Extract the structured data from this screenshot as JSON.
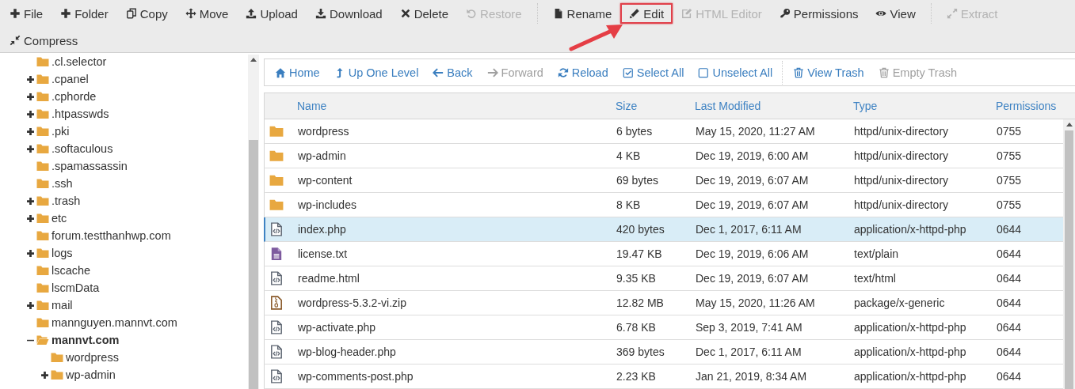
{
  "toolbar": {
    "callout_arrow": true,
    "groups": [
      {
        "buttons": [
          {
            "label": "File",
            "kind": "plus",
            "disabled": false,
            "highlighted": false
          },
          {
            "label": "Folder",
            "kind": "plus",
            "disabled": false,
            "highlighted": false
          },
          {
            "label": "Copy",
            "kind": "copy",
            "disabled": false,
            "highlighted": false
          },
          {
            "label": "Move",
            "kind": "move",
            "disabled": false,
            "highlighted": false
          },
          {
            "label": "Upload",
            "kind": "upload",
            "disabled": false,
            "highlighted": false
          },
          {
            "label": "Download",
            "kind": "download",
            "disabled": false,
            "highlighted": false
          },
          {
            "label": "Delete",
            "kind": "times",
            "disabled": false,
            "highlighted": false
          },
          {
            "label": "Restore",
            "kind": "undo",
            "disabled": true,
            "highlighted": false
          }
        ]
      },
      {
        "buttons": [
          {
            "label": "Rename",
            "kind": "file",
            "disabled": false,
            "highlighted": false
          },
          {
            "label": "Edit",
            "kind": "pencil",
            "disabled": false,
            "highlighted": true
          },
          {
            "label": "HTML Editor",
            "kind": "edit",
            "disabled": true,
            "highlighted": false
          },
          {
            "label": "Permissions",
            "kind": "key",
            "disabled": false,
            "highlighted": false
          },
          {
            "label": "View",
            "kind": "eye",
            "disabled": false,
            "highlighted": false
          }
        ]
      },
      {
        "buttons": [
          {
            "label": "Extract",
            "kind": "expand",
            "disabled": true,
            "highlighted": false
          },
          {
            "label": "Compress",
            "kind": "compress",
            "disabled": false,
            "highlighted": false
          }
        ]
      }
    ]
  },
  "tree": [
    {
      "label": ".cl.selector",
      "kind": "leaf",
      "selected": false
    },
    {
      "label": ".cpanel",
      "kind": "collapsed",
      "selected": false
    },
    {
      "label": ".cphorde",
      "kind": "collapsed",
      "selected": false
    },
    {
      "label": ".htpasswds",
      "kind": "collapsed",
      "selected": false
    },
    {
      "label": ".pki",
      "kind": "collapsed",
      "selected": false
    },
    {
      "label": ".softaculous",
      "kind": "collapsed",
      "selected": false
    },
    {
      "label": ".spamassassin",
      "kind": "leaf",
      "selected": false
    },
    {
      "label": ".ssh",
      "kind": "leaf",
      "selected": false
    },
    {
      "label": ".trash",
      "kind": "collapsed",
      "selected": false
    },
    {
      "label": "etc",
      "kind": "collapsed",
      "selected": false
    },
    {
      "label": "forum.testthanhwp.com",
      "kind": "leaf",
      "selected": false
    },
    {
      "label": "logs",
      "kind": "collapsed",
      "selected": false
    },
    {
      "label": "lscache",
      "kind": "leaf",
      "selected": false
    },
    {
      "label": "lscmData",
      "kind": "leaf",
      "selected": false
    },
    {
      "label": "mail",
      "kind": "collapsed",
      "selected": false
    },
    {
      "label": "mannguyen.mannvt.com",
      "kind": "leaf",
      "selected": false
    },
    {
      "label": "mannvt.com",
      "kind": "expanded",
      "selected": true,
      "children": [
        {
          "label": "wordpress",
          "kind": "leaf",
          "selected": false
        },
        {
          "label": "wp-admin",
          "kind": "collapsed",
          "selected": false
        }
      ]
    }
  ],
  "nav": {
    "groups": [
      {
        "buttons": [
          {
            "label": "Home",
            "kind": "home",
            "disabled": false
          },
          {
            "label": "Up One Level",
            "kind": "up",
            "disabled": false
          },
          {
            "label": "Back",
            "kind": "left",
            "disabled": false
          },
          {
            "label": "Forward",
            "kind": "right",
            "disabled": true
          },
          {
            "label": "Reload",
            "kind": "reload",
            "disabled": false
          },
          {
            "label": "Select All",
            "kind": "checked",
            "disabled": false
          },
          {
            "label": "Unselect All",
            "kind": "unchecked",
            "disabled": false
          }
        ]
      },
      {
        "buttons": [
          {
            "label": "View Trash",
            "kind": "trash",
            "disabled": false
          },
          {
            "label": "Empty Trash",
            "kind": "trash",
            "disabled": true
          }
        ]
      }
    ]
  },
  "table": {
    "columns": [
      "Name",
      "Size",
      "Last Modified",
      "Type",
      "Permissions"
    ],
    "rows": [
      {
        "kind": "folder",
        "name": "wordpress",
        "size": "6 bytes",
        "modified": "May 15, 2020, 11:27 AM",
        "type": "httpd/unix-directory",
        "permissions": "0755",
        "selected": false
      },
      {
        "kind": "folder",
        "name": "wp-admin",
        "size": "4 KB",
        "modified": "Dec 19, 2019, 6:00 AM",
        "type": "httpd/unix-directory",
        "permissions": "0755",
        "selected": false
      },
      {
        "kind": "folder",
        "name": "wp-content",
        "size": "69 bytes",
        "modified": "Dec 19, 2019, 6:07 AM",
        "type": "httpd/unix-directory",
        "permissions": "0755",
        "selected": false
      },
      {
        "kind": "folder",
        "name": "wp-includes",
        "size": "8 KB",
        "modified": "Dec 19, 2019, 6:07 AM",
        "type": "httpd/unix-directory",
        "permissions": "0755",
        "selected": false
      },
      {
        "kind": "code",
        "name": "index.php",
        "size": "420 bytes",
        "modified": "Dec 1, 2017, 6:11 AM",
        "type": "application/x-httpd-php",
        "permissions": "0644",
        "selected": true
      },
      {
        "kind": "text",
        "name": "license.txt",
        "size": "19.47 KB",
        "modified": "Dec 19, 2019, 6:06 AM",
        "type": "text/plain",
        "permissions": "0644",
        "selected": false
      },
      {
        "kind": "code",
        "name": "readme.html",
        "size": "9.35 KB",
        "modified": "Dec 19, 2019, 6:07 AM",
        "type": "text/html",
        "permissions": "0644",
        "selected": false
      },
      {
        "kind": "zip",
        "name": "wordpress-5.3.2-vi.zip",
        "size": "12.82 MB",
        "modified": "May 15, 2020, 11:26 AM",
        "type": "package/x-generic",
        "permissions": "0644",
        "selected": false
      },
      {
        "kind": "code",
        "name": "wp-activate.php",
        "size": "6.78 KB",
        "modified": "Sep 3, 2019, 7:41 AM",
        "type": "application/x-httpd-php",
        "permissions": "0644",
        "selected": false
      },
      {
        "kind": "code",
        "name": "wp-blog-header.php",
        "size": "369 bytes",
        "modified": "Dec 1, 2017, 6:11 AM",
        "type": "application/x-httpd-php",
        "permissions": "0644",
        "selected": false
      },
      {
        "kind": "code",
        "name": "wp-comments-post.php",
        "size": "2.23 KB",
        "modified": "Jan 21, 2019, 8:34 AM",
        "type": "application/x-httpd-php",
        "permissions": "0644",
        "selected": false
      }
    ]
  }
}
